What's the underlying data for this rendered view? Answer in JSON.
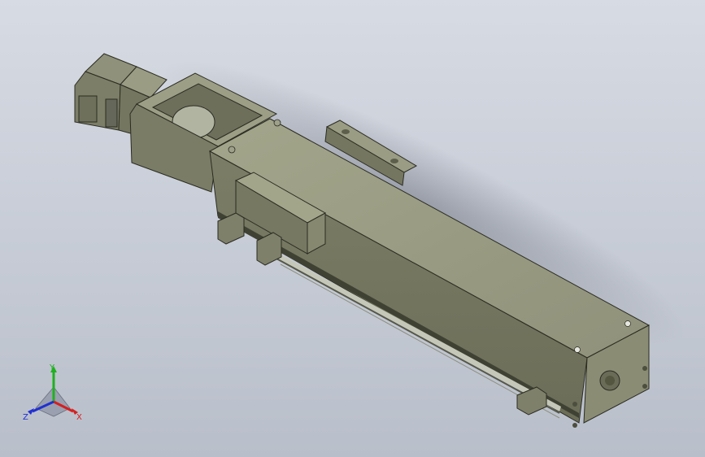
{
  "viewport": {
    "background_top": "#d7dbe3",
    "background_bottom": "#b9bfca",
    "model_color": "#8b8d74",
    "model_shadow": "#5a5c48",
    "model_highlight": "#a4a68c"
  },
  "triad": {
    "x_label": "X",
    "y_label": "Y",
    "z_label": "Z",
    "x_color": "#d42020",
    "y_color": "#20b020",
    "z_color": "#2030d0"
  }
}
